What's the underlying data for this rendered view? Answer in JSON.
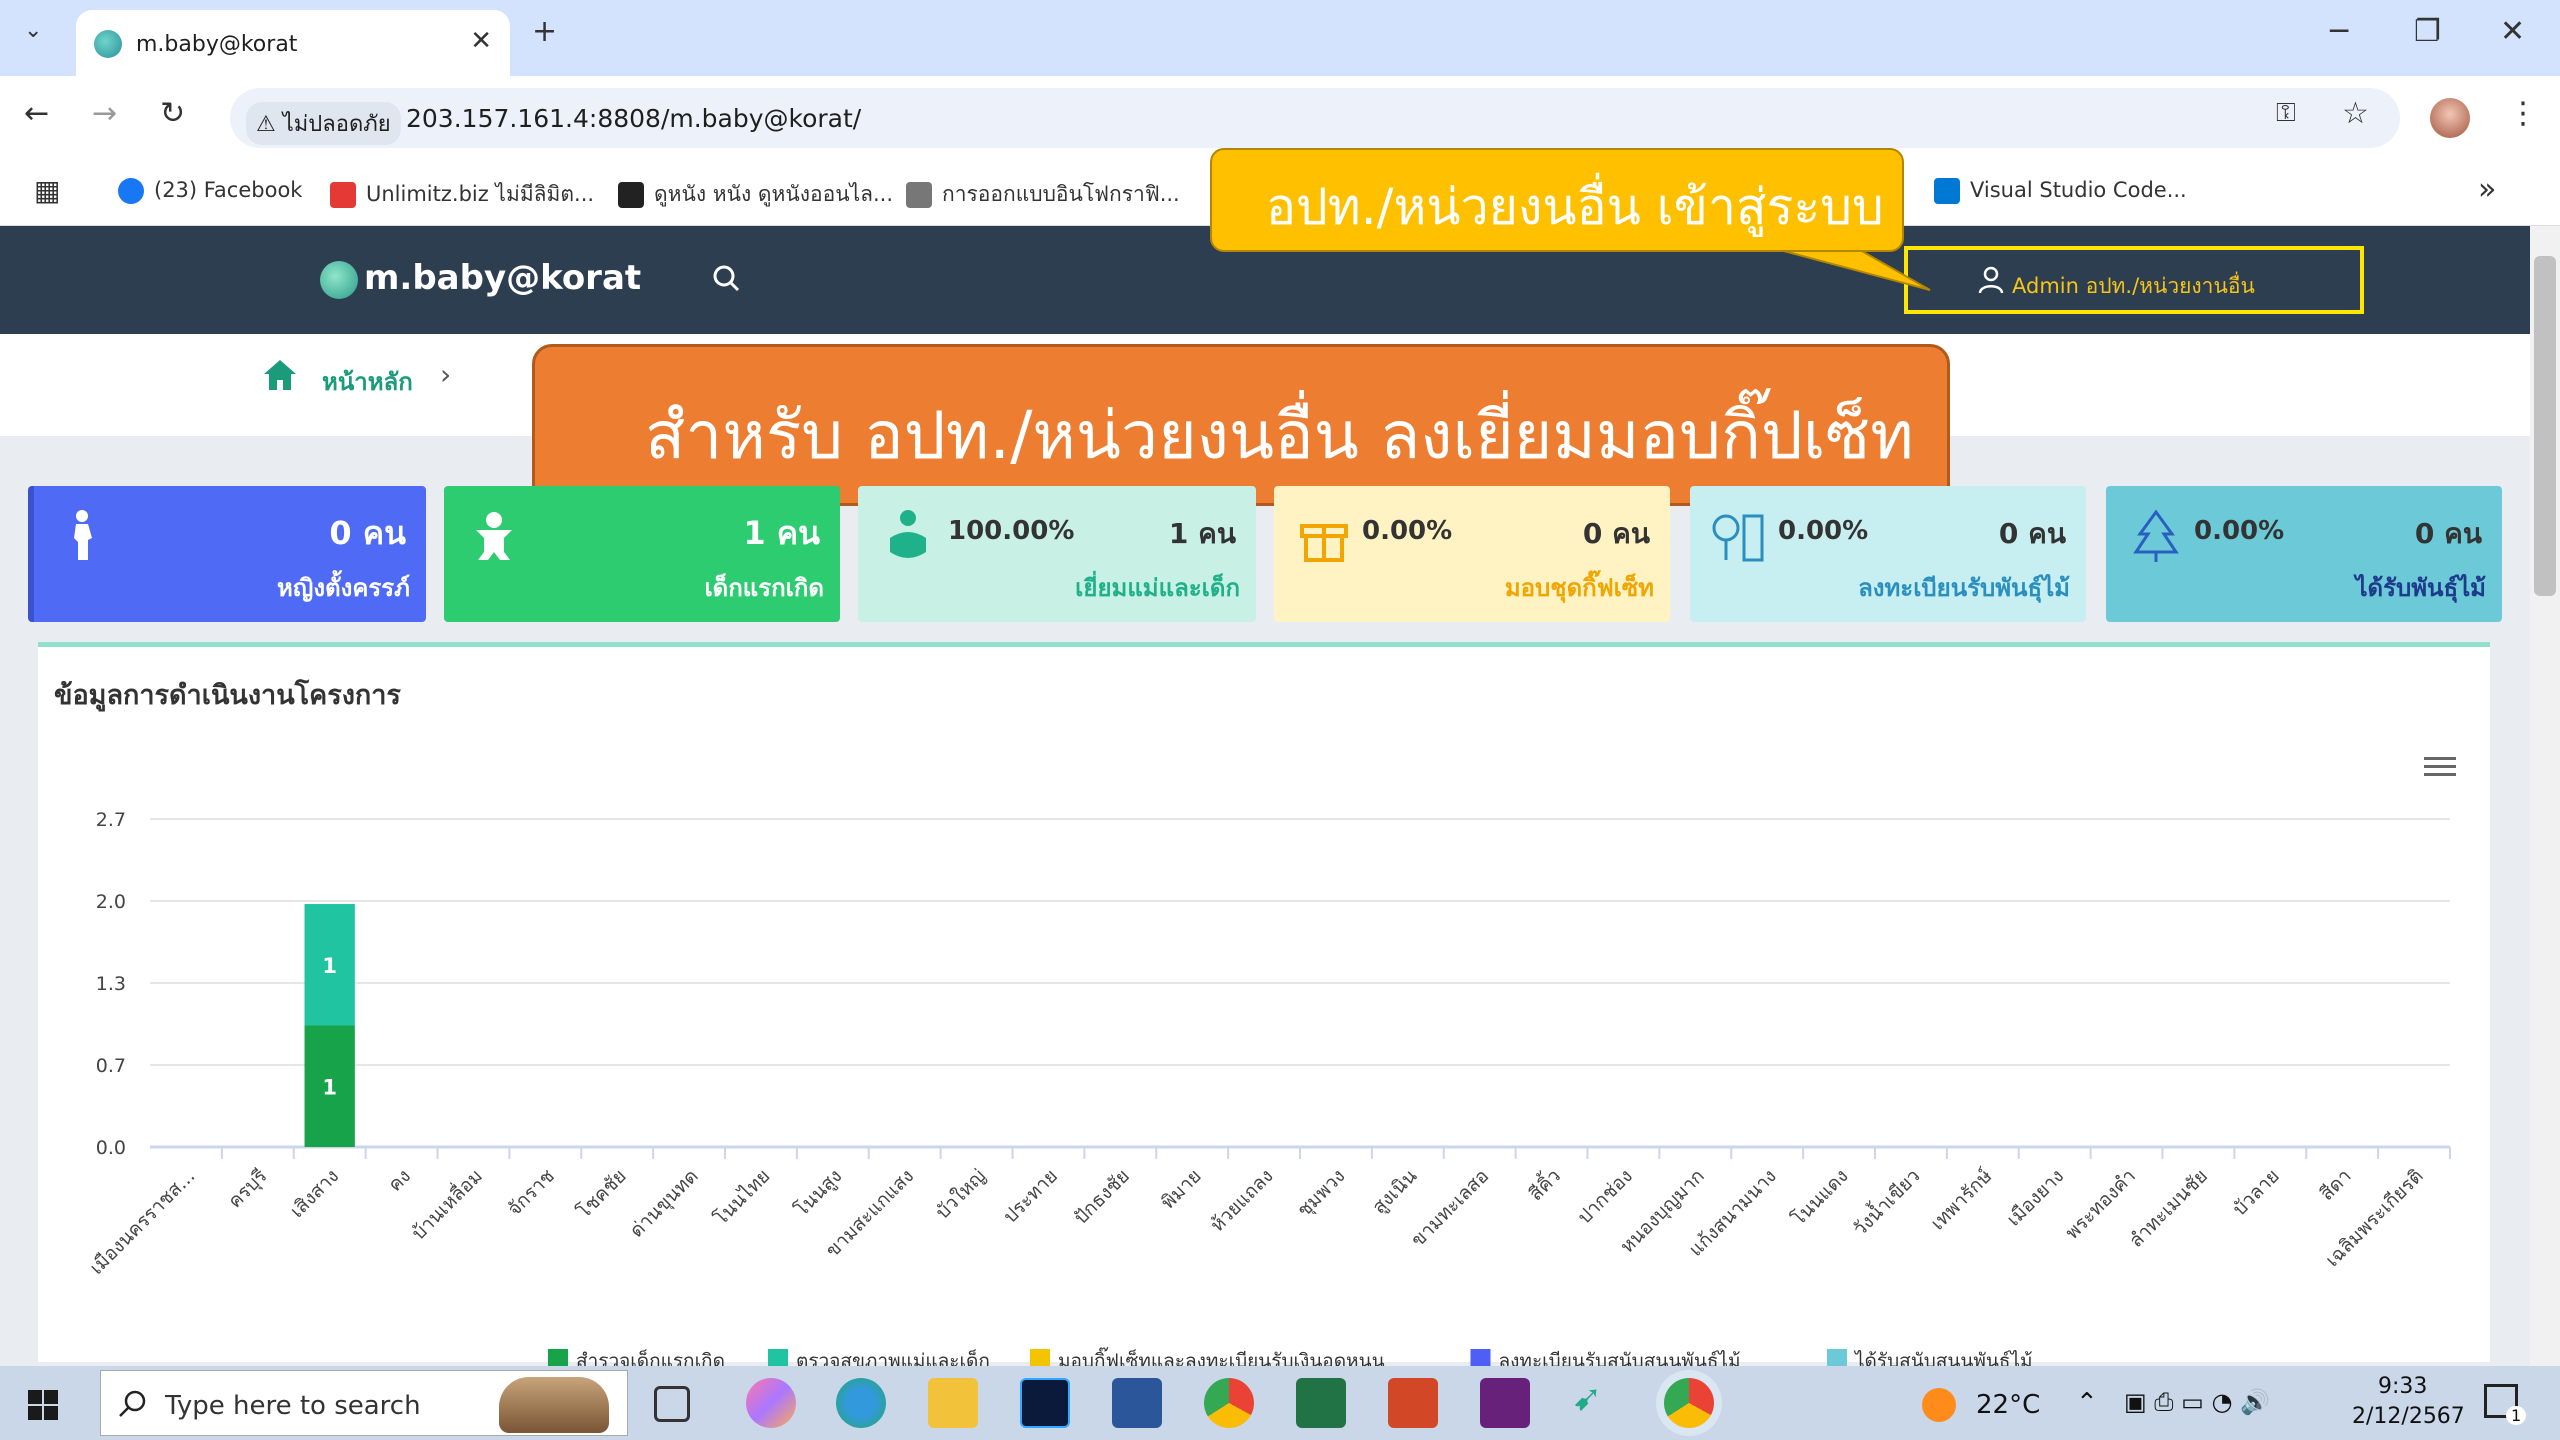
{
  "browser": {
    "tab_title": "m.baby@korat",
    "tab_close": "✕",
    "new_tab": "+",
    "security_label": "ไม่ปลอดภัย",
    "url": "203.157.161.4:8808/m.baby@korat/",
    "bookmarks": [
      {
        "label": "(23) Facebook",
        "color": "#1877f2"
      },
      {
        "label": "Unlimitz.biz ไม่มีลิมิต...",
        "color": "#e53935"
      },
      {
        "label": "ดูหนัง หนัง ดูหนังออนไล...",
        "color": "#222222"
      },
      {
        "label": "การออกแบบอินโฟกราฟิ...",
        "color": "#555555"
      },
      {
        "label": "Visual Studio Code...",
        "color": "#0078d4"
      }
    ],
    "more_bookmarks": "»"
  },
  "site": {
    "logo": "m.baby@korat",
    "user_label": "Admin อปท./หน่วยงานอื่น",
    "breadcrumb_home": "หน้าหลัก",
    "breadcrumb_sep": "›"
  },
  "callouts": {
    "top": "อปท./หน่วยงนอื่น เข้าสู่ระบบ",
    "main": "สำหรับ อปท./หน่วยงนอื่น ลงเยี่ยมมอบกิ๊ปเซ็ท"
  },
  "cards": [
    {
      "value": "0 คน",
      "label": "หญิงตั้งครรภ์",
      "pct": "",
      "bg": "#4f6af5",
      "fg": "#ffffff"
    },
    {
      "value": "1 คน",
      "label": "เด็กแรกเกิด",
      "pct": "",
      "bg": "#2ecc71",
      "fg": "#ffffff"
    },
    {
      "value": "1 คน",
      "label": "เยี่ยมแม่และเด็ก",
      "pct": "100.00%",
      "bg": "#c8f0e4",
      "fg": "#1fb28a"
    },
    {
      "value": "0 คน",
      "label": "มอบชุดกิ๊ฟเซ็ท",
      "pct": "0.00%",
      "bg": "#fff3c4",
      "fg": "#f0a500"
    },
    {
      "value": "0 คน",
      "label": "ลงทะเบียนรับพันธุ์ไม้",
      "pct": "0.00%",
      "bg": "#c7eef0",
      "fg": "#2a8fbf"
    },
    {
      "value": "0 คน",
      "label": "ได้รับพันธุ์ไม้",
      "pct": "0.00%",
      "bg": "#6ccad8",
      "fg": "#1e3a8a"
    }
  ],
  "panel": {
    "title": "ข้อมูลการดำเนินงานโครงการ"
  },
  "chart_data": {
    "type": "bar",
    "stacked": true,
    "title": "",
    "xlabel": "",
    "ylabel": "",
    "ylim": [
      0,
      2.7
    ],
    "yticks": [
      "0.0",
      "0.7",
      "1.3",
      "2.0",
      "2.7"
    ],
    "categories": [
      "เมืองนครราชส...",
      "ครบุรี",
      "เสิงสาง",
      "คง",
      "บ้านเหลื่อม",
      "จักราช",
      "โชคชัย",
      "ด่านขุนทด",
      "โนนไทย",
      "โนนสูง",
      "ขามสะแกแสง",
      "บัวใหญ่",
      "ประทาย",
      "ปักธงชัย",
      "พิมาย",
      "ห้วยแถลง",
      "ชุมพวง",
      "สูงเนิน",
      "ขามทะเลสอ",
      "สีคิ้ว",
      "ปากช่อง",
      "หนองบุญมาก",
      "แก้งสนามนาง",
      "โนนแดง",
      "วังน้ำเขียว",
      "เทพารักษ์",
      "เมืองยาง",
      "พระทองคำ",
      "ลำทะเมนชัย",
      "บัวลาย",
      "สีดา",
      "เฉลิมพระเกียรติ"
    ],
    "series": [
      {
        "name": "สำรวจเด็กแรกเกิด",
        "color": "#16a34a",
        "values": [
          0,
          0,
          1,
          0,
          0,
          0,
          0,
          0,
          0,
          0,
          0,
          0,
          0,
          0,
          0,
          0,
          0,
          0,
          0,
          0,
          0,
          0,
          0,
          0,
          0,
          0,
          0,
          0,
          0,
          0,
          0,
          0
        ]
      },
      {
        "name": "ตรวจสุขภาพแม่และเด็ก",
        "color": "#20c4a0",
        "values": [
          0,
          0,
          1,
          0,
          0,
          0,
          0,
          0,
          0,
          0,
          0,
          0,
          0,
          0,
          0,
          0,
          0,
          0,
          0,
          0,
          0,
          0,
          0,
          0,
          0,
          0,
          0,
          0,
          0,
          0,
          0,
          0
        ]
      },
      {
        "name": "มอบกิ๊ฟเซ็ทและลงทะเบียนรับเงินอุดหนุน",
        "color": "#f5c400",
        "values": [
          0,
          0,
          0,
          0,
          0,
          0,
          0,
          0,
          0,
          0,
          0,
          0,
          0,
          0,
          0,
          0,
          0,
          0,
          0,
          0,
          0,
          0,
          0,
          0,
          0,
          0,
          0,
          0,
          0,
          0,
          0,
          0
        ]
      },
      {
        "name": "ลงทะเบียนรับสนับสนุนพันธุ์ไม้",
        "color": "#4f5ff5",
        "values": [
          0,
          0,
          0,
          0,
          0,
          0,
          0,
          0,
          0,
          0,
          0,
          0,
          0,
          0,
          0,
          0,
          0,
          0,
          0,
          0,
          0,
          0,
          0,
          0,
          0,
          0,
          0,
          0,
          0,
          0,
          0,
          0
        ]
      },
      {
        "name": "ได้รับสนับสนุนพันธุ์ไม้",
        "color": "#6ccad8",
        "values": [
          0,
          0,
          0,
          0,
          0,
          0,
          0,
          0,
          0,
          0,
          0,
          0,
          0,
          0,
          0,
          0,
          0,
          0,
          0,
          0,
          0,
          0,
          0,
          0,
          0,
          0,
          0,
          0,
          0,
          0,
          0,
          0
        ]
      }
    ],
    "data_labels": true,
    "grid": true,
    "legend": "bottom"
  },
  "taskbar": {
    "search_placeholder": "Type here to search",
    "weather": "22°C",
    "time": "9:33",
    "date": "2/12/2567",
    "notifications": "1"
  }
}
